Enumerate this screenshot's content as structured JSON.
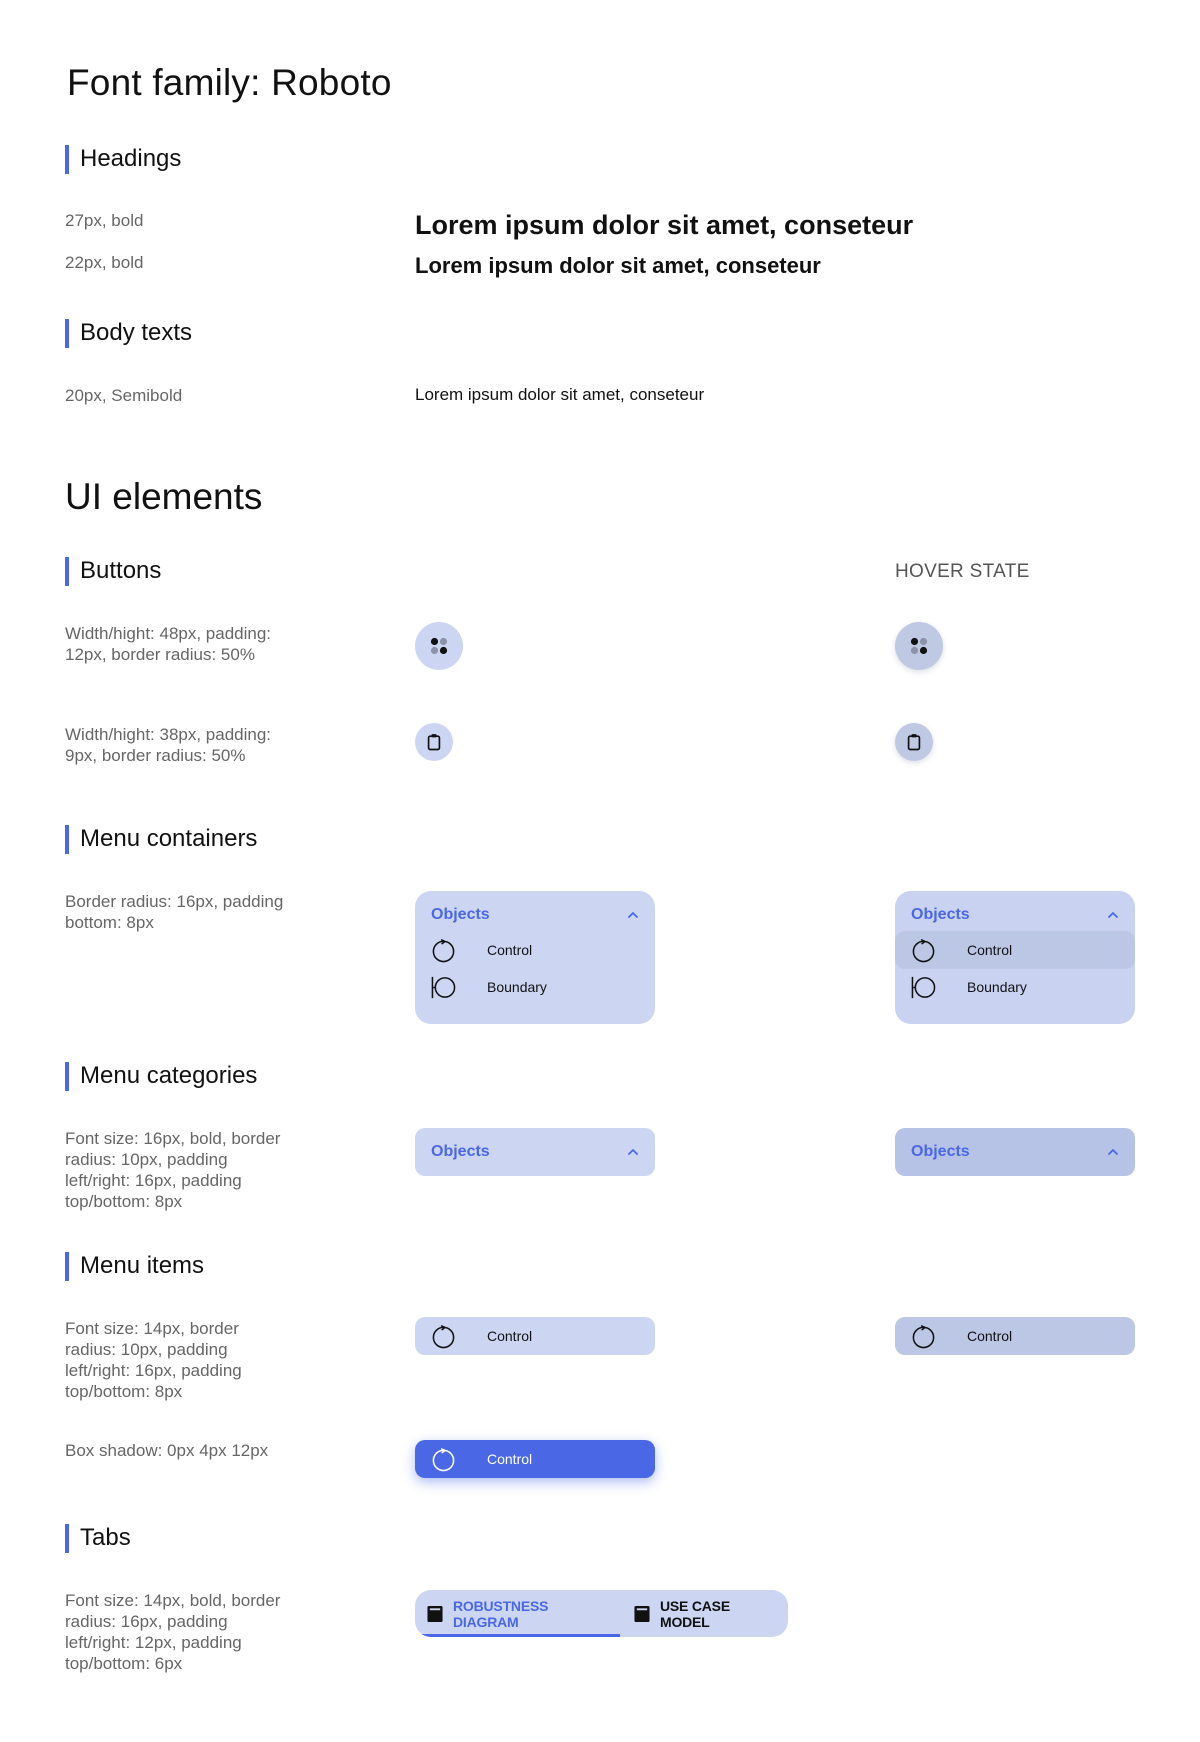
{
  "page": {
    "font_title": "Font family: Roboto",
    "ui_title": "UI elements",
    "hover_state_label": "HOVER STATE"
  },
  "sections": {
    "headings": "Headings",
    "body_texts": "Body texts",
    "buttons": "Buttons",
    "menu_containers": "Menu containers",
    "menu_categories": "Menu categories",
    "menu_items": "Menu items",
    "tabs": "Tabs"
  },
  "specs": {
    "h27": "27px, bold",
    "h22": "22px, bold",
    "body20": "20px, Semibold",
    "btn_large": "Width/hight: 48px, padding: 12px, border radius: 50%",
    "btn_small": "Width/hight: 38px, padding: 9px, border radius: 50%",
    "menu_container": "Border radius: 16px, padding bottom: 8px",
    "menu_category": "Font size: 16px, bold, border radius: 10px, padding left/right: 16px, padding top/bottom: 8px",
    "menu_item": "Font size: 14px, border radius: 10px, padding left/right: 16px, padding top/bottom: 8px",
    "menu_item_shadow": "Box shadow: 0px 4px 12px",
    "tabs": "Font size: 14px, bold, border radius: 16px, padding left/right: 12px, padding top/bottom: 6px"
  },
  "samples": {
    "h27": "Lorem ipsum dolor sit amet, conseteur",
    "h22": "Lorem ipsum dolor sit amet, conseteur",
    "body": "Lorem ipsum dolor sit amet, conseteur"
  },
  "menu": {
    "category_label": "Objects",
    "items": [
      "Control",
      "Boundary"
    ],
    "single_item": "Control"
  },
  "tabs": [
    "ROBUSTNESS DIAGRAM",
    "USE CASE MODEL"
  ],
  "colors": {
    "accent": "#4a68e6",
    "surface": "#ccd6f3",
    "surface_hover": "#bcc7e6"
  },
  "icons": {
    "large_button": "dots-grid-icon",
    "small_button": "clipboard-icon",
    "control": "control-circle-icon",
    "boundary": "boundary-circle-icon",
    "tab": "document-icon"
  }
}
